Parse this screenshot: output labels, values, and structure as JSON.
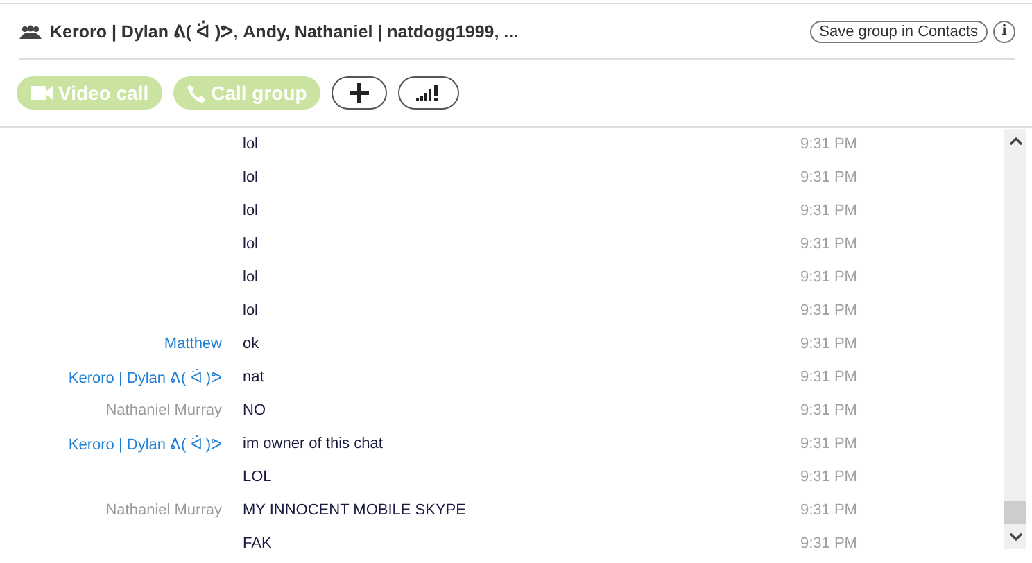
{
  "header": {
    "title": "Keroro | Dylan ᕕ( ᐛ )ᕗ, Andy, Nathaniel | natdogg1999, ...",
    "save_button": "Save group in Contacts",
    "info_button": "i"
  },
  "toolbar": {
    "buttons": [
      {
        "kind": "video",
        "label": "Video call",
        "disabled": true
      },
      {
        "kind": "call",
        "label": "Call group",
        "disabled": true
      },
      {
        "kind": "add"
      },
      {
        "kind": "signal"
      }
    ]
  },
  "messages": [
    {
      "text": "lol",
      "time": "9:31 PM"
    },
    {
      "text": "lol",
      "time": "9:31 PM"
    },
    {
      "text": "lol",
      "time": "9:31 PM"
    },
    {
      "text": "lol",
      "time": "9:31 PM"
    },
    {
      "text": "lol",
      "time": "9:31 PM"
    },
    {
      "text": "lol",
      "time": "9:31 PM"
    },
    {
      "sender": "Matthew",
      "color": "#1f7fd4",
      "text": "ok",
      "time": "9:31 PM"
    },
    {
      "sender": "Keroro | Dylan ᕕ( ᐛ )ᕗ",
      "color": "#1f7fd4",
      "text": "nat",
      "time": "9:31 PM"
    },
    {
      "sender": "Nathaniel Murray",
      "color": "#9a9a9a",
      "text": "NO",
      "time": "9:31 PM"
    },
    {
      "sender": "Keroro | Dylan ᕕ( ᐛ )ᕗ",
      "color": "#1f7fd4",
      "text": "im owner of this chat",
      "time": "9:31 PM"
    },
    {
      "text": "LOL",
      "time": "9:31 PM"
    },
    {
      "sender": "Nathaniel Murray",
      "color": "#9a9a9a",
      "text": "MY INNOCENT MOBILE SKYPE",
      "time": "9:31 PM"
    },
    {
      "text": "FAK",
      "time": "9:31 PM"
    }
  ]
}
